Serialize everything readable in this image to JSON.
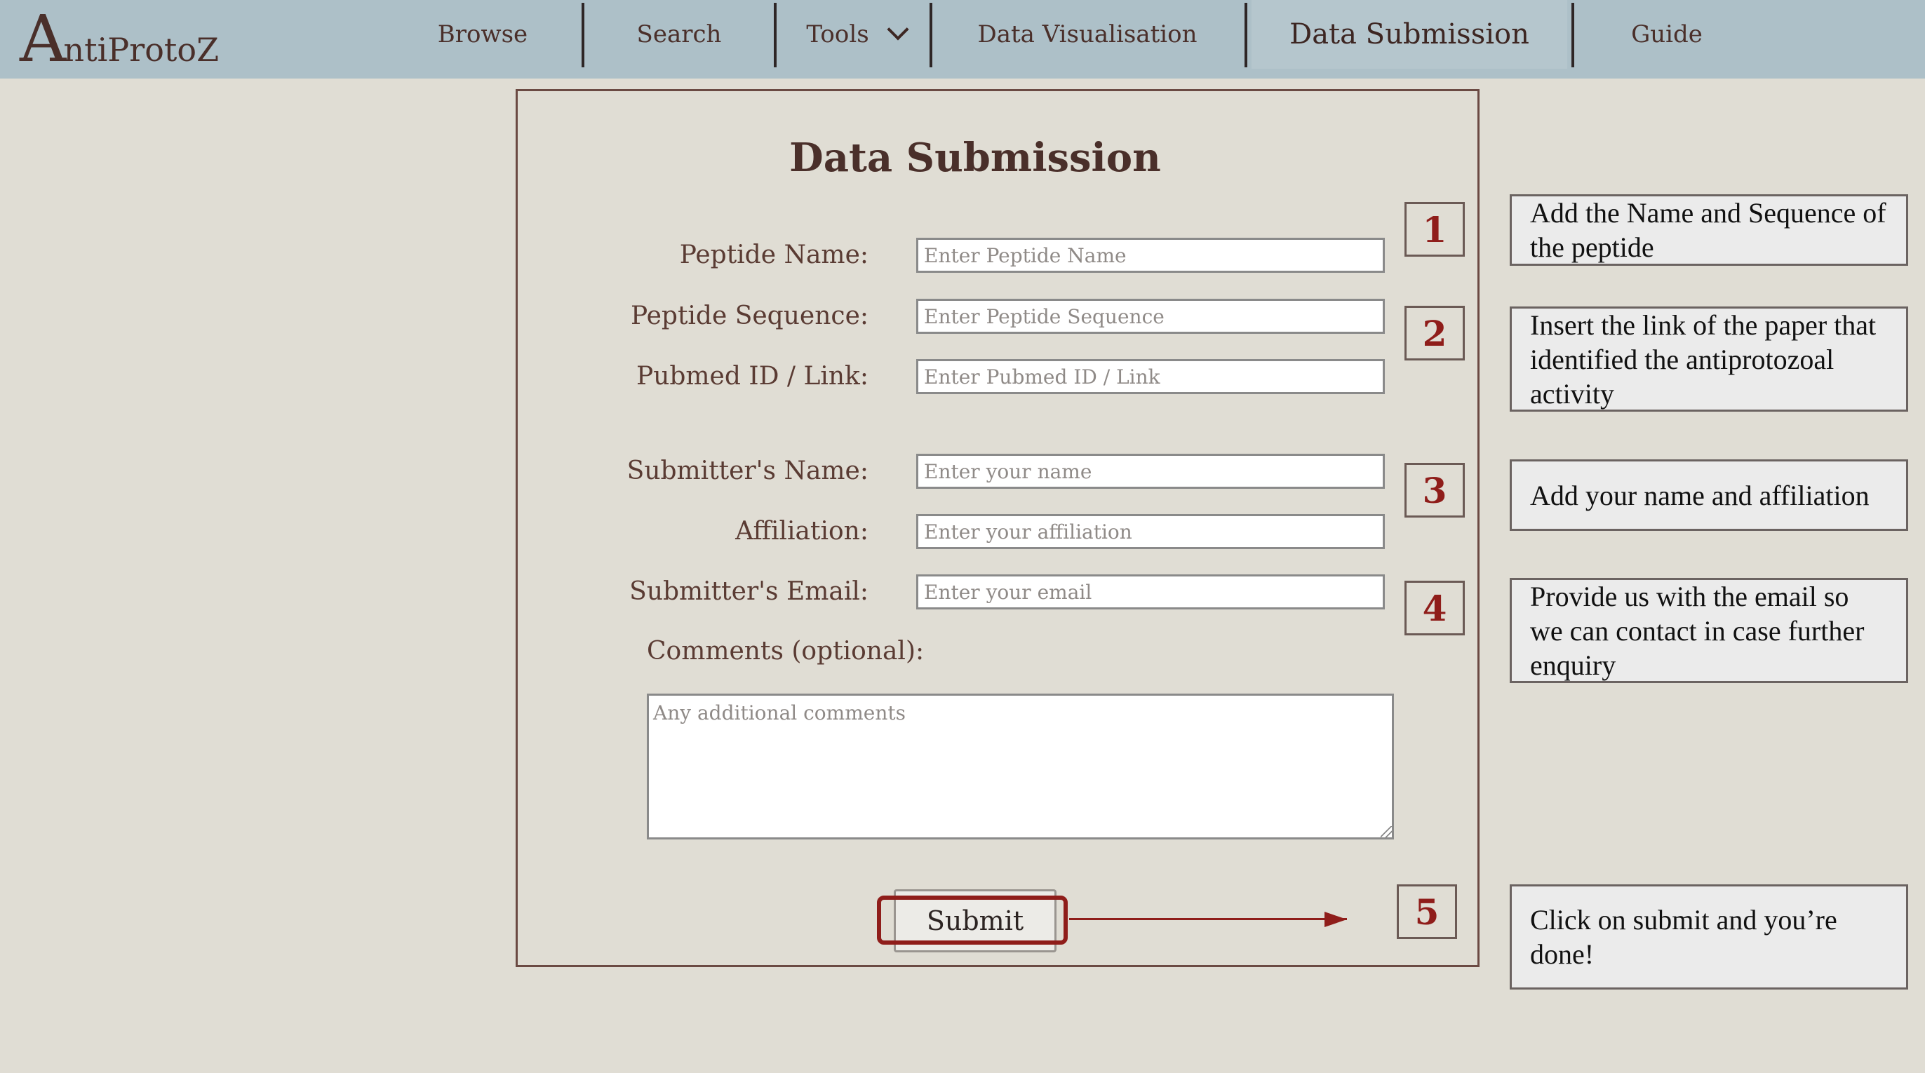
{
  "nav": {
    "logo_first": "A",
    "logo_rest": "ntiProtoZ",
    "items": [
      {
        "label": "Browse"
      },
      {
        "label": "Search"
      },
      {
        "label": "Tools"
      },
      {
        "label": "Data Visualisation"
      },
      {
        "label": "Data Submission"
      },
      {
        "label": "Guide"
      }
    ],
    "active_item": "Data Submission",
    "tools_icon": "chevron-down-icon"
  },
  "form": {
    "title": "Data Submission",
    "fields": {
      "peptide_name": {
        "label": "Peptide Name:",
        "placeholder": "Enter Peptide Name",
        "value": ""
      },
      "peptide_sequence": {
        "label": "Peptide Sequence:",
        "placeholder": "Enter Peptide Sequence",
        "value": ""
      },
      "pubmed": {
        "label": "Pubmed ID / Link:",
        "placeholder": "Enter Pubmed ID / Link",
        "value": ""
      },
      "submitter_name": {
        "label": "Submitter's Name:",
        "placeholder": "Enter your name",
        "value": ""
      },
      "affiliation": {
        "label": "Affiliation:",
        "placeholder": "Enter your affiliation",
        "value": ""
      },
      "email": {
        "label": "Submitter's Email:",
        "placeholder": "Enter your email",
        "value": ""
      },
      "comments": {
        "label": "Comments (optional):",
        "placeholder": "Any additional comments",
        "value": ""
      }
    },
    "submit_label": "Submit"
  },
  "steps": [
    {
      "number": "1",
      "note": "Add the Name and Sequence of the peptide"
    },
    {
      "number": "2",
      "note": "Insert the link of the paper that identified the antiprotozoal activity"
    },
    {
      "number": "3",
      "note": "Add your name and affiliation"
    },
    {
      "number": "4",
      "note": "Provide us with the email so we can contact in case further enquiry"
    },
    {
      "number": "5",
      "note": "Click on  submit and you’re done!"
    }
  ],
  "colors": {
    "page_background": "#e0ddd4",
    "navbar": "#adc0c8",
    "accent_red": "#8f1d1a",
    "text_brown": "#5a3b33",
    "note_background": "#ebebeb"
  }
}
